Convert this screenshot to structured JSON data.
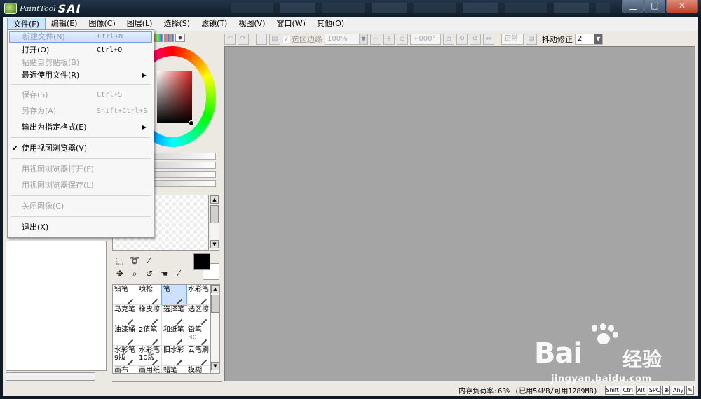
{
  "app": {
    "title_part1": "PaintTool",
    "title_part2": "SAI",
    "window_buttons": {
      "minimize": "▁",
      "maximize": "□",
      "close": "✕"
    }
  },
  "menubar": {
    "items": [
      {
        "label": "文件(F)",
        "active": true
      },
      {
        "label": "编辑(E)"
      },
      {
        "label": "图像(C)"
      },
      {
        "label": "图层(L)"
      },
      {
        "label": "选择(S)"
      },
      {
        "label": "滤镜(T)"
      },
      {
        "label": "视图(V)"
      },
      {
        "label": "窗口(W)"
      },
      {
        "label": "其他(O)"
      }
    ]
  },
  "file_menu": {
    "items": [
      {
        "label": "新建文件(N)",
        "shortcut": "Ctrl+N",
        "state": "hover"
      },
      {
        "label": "打开(O)",
        "shortcut": "Ctrl+O"
      },
      {
        "label": "粘贴自剪贴板(B)",
        "state": "disabled"
      },
      {
        "label": "最近使用文件(R)",
        "submenu": true
      },
      {
        "label": "保存(S)",
        "shortcut": "Ctrl+S",
        "state": "disabled"
      },
      {
        "label": "另存为(A)",
        "shortcut": "Shift+Ctrl+S",
        "state": "disabled"
      },
      {
        "label": "输出为指定格式(E)",
        "submenu": true
      },
      {
        "label": "使用视图浏览器(V)",
        "checked": true
      },
      {
        "label": "用视图浏览器打开(F)",
        "state": "disabled"
      },
      {
        "label": "用视图浏览器保存(L)",
        "state": "disabled"
      },
      {
        "label": "关闭图像(C)",
        "state": "disabled"
      },
      {
        "label": "退出(X)"
      }
    ]
  },
  "toolbar": {
    "selection_edge_label": "选区边缘",
    "zoom_value": "100%",
    "rotation_value": "+000°",
    "blend_mode": "正常",
    "stabilizer_label": "抖动修正",
    "stabilizer_value": "2"
  },
  "brushes": [
    "铅笔",
    "喷枪",
    "笔",
    "水彩笔",
    "马克笔",
    "橡皮擦",
    "选择笔",
    "选区擦",
    "油漆桶",
    "2值笔",
    "和纸笔",
    "铅笔30",
    "水彩笔9版",
    "水彩笔10版",
    "旧水彩",
    "云笔刷",
    "画布",
    "画用纸",
    "蜡笔",
    "模糊"
  ],
  "selected_brush": "笔",
  "status": {
    "memory": "内存负荷率:63% (已用54MB/可用1289MB)",
    "keys": [
      "Shift",
      "Ctrl",
      "Alt",
      "SPC",
      "⊕",
      "Any",
      "✎"
    ]
  },
  "watermark": {
    "brand": "Bai",
    "brand_suffix": "经验",
    "url": "jingyan.baidu.com"
  },
  "colors": {
    "canvas_bg": "#a5a5a5",
    "panel_bg": "#ece9e3",
    "titlebar": "#101c28",
    "hover_accent": "#cbdcfb"
  }
}
